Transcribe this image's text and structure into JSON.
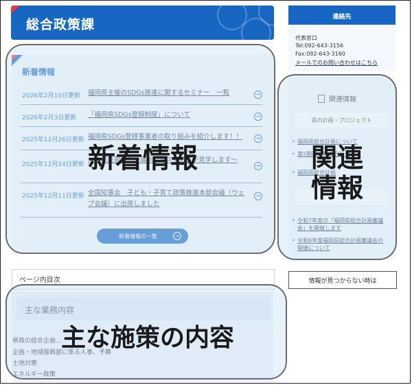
{
  "header": {
    "title": "総合政策課"
  },
  "news": {
    "heading": "新着情報",
    "items": [
      {
        "date": "2026年2月10日更新",
        "title": "福岡県主催のSDGs推進に関するセミナー　一覧"
      },
      {
        "date": "2026年2月3日更新",
        "title": "「福岡県SDGs登録制度」について"
      },
      {
        "date": "2025年12月26日更新",
        "title": "福岡県SDGs登録事業者の取り組みを紹介します！！"
      },
      {
        "date": "2025年12月24日更新",
        "title": "…の実証開始！～展示ブースを知事が見学します～"
      },
      {
        "date": "2025年12月11日更新",
        "title": "全国知事会　子ども・子育て政策推進本部会議（ウェブ会議）に出席しました"
      }
    ],
    "more_button": "新着情報の一覧",
    "arrow": "arrow-right-circle-icon"
  },
  "toc": {
    "label": "ページ内目次"
  },
  "business": {
    "heading": "主な業務内容",
    "items": [
      "県政の総合企画…",
      "企画・地域振興部に係る人事、予算",
      "土地対策",
      "エネルギー政策"
    ]
  },
  "contact": {
    "heading": "連絡先",
    "office": "代表窓口",
    "tel": "Tel:092-643-3156",
    "fax": "Fax:092-643-3160",
    "mail_link": "メールでのお問い合わせはこちら"
  },
  "related": {
    "heading": "関連情報",
    "sub1": "県の計画・プロジェクト",
    "links_top": [
      "福岡県総合計画について",
      "第5期福岡県総合計画",
      "福岡県総合計画"
    ],
    "links_bottom": [
      "令和7年度の「福岡県総合計画審議会」を開催します",
      "令和6年度福岡県総合計画審議会の開催について"
    ]
  },
  "not_found": {
    "label": "情報が見つからない時は"
  },
  "overlays": {
    "news": "新着情報",
    "related_line1": "関連",
    "related_line2": "情報",
    "business": "主な施策の内容"
  },
  "colors": {
    "accent": "#1766c2",
    "corner_red": "#e63b3b",
    "panel": "#f4f8fc"
  }
}
